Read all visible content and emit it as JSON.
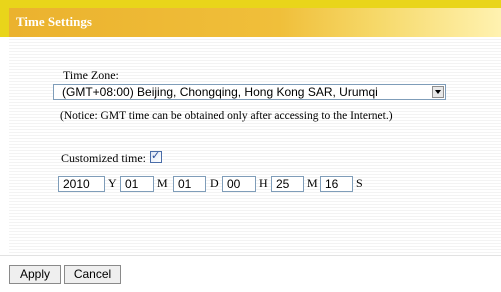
{
  "header": {
    "title": "Time Settings"
  },
  "time_zone": {
    "label": "Time Zone:",
    "selected": "(GMT+08:00) Beijing, Chongqing, Hong Kong SAR, Urumqi",
    "notice": "(Notice: GMT time can be obtained only after accessing to the Internet.)"
  },
  "customized": {
    "label": "Customized time:",
    "checked": true,
    "check_glyph": "✓",
    "year": "2010",
    "year_unit": "Y",
    "month": "01",
    "month_unit": "M",
    "day": "01",
    "day_unit": "D",
    "hour": "00",
    "hour_unit": "H",
    "minute": "25",
    "minute_unit": "M",
    "second": "16",
    "second_unit": "S"
  },
  "buttons": {
    "apply": "Apply",
    "cancel": "Cancel"
  },
  "colors": {
    "header_yellow": "#e9d51a",
    "title_bar_orange": "#ebb22e"
  }
}
